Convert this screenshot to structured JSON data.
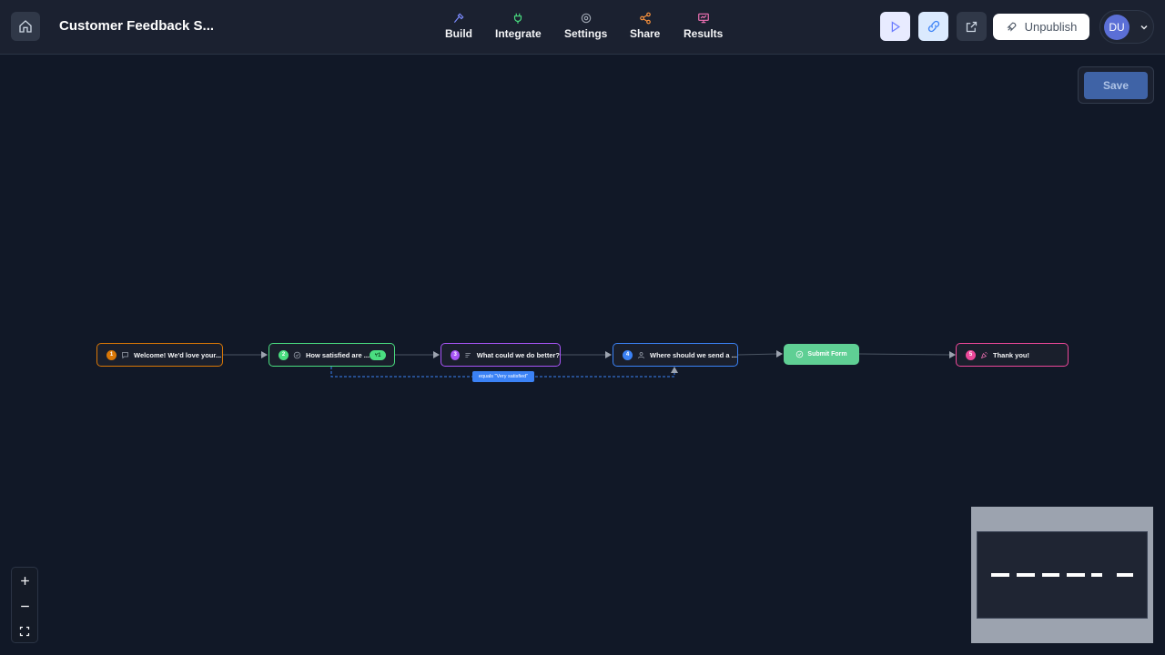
{
  "header": {
    "title": "Customer Feedback S...",
    "nav": [
      {
        "label": "Build",
        "icon": "hammer-icon",
        "color": "#6b7cff"
      },
      {
        "label": "Integrate",
        "icon": "plug-icon",
        "color": "#4ade80"
      },
      {
        "label": "Settings",
        "icon": "gear-icon",
        "color": "#9ca3af"
      },
      {
        "label": "Share",
        "icon": "share-icon",
        "color": "#fb923c"
      },
      {
        "label": "Results",
        "icon": "monitor-chart-icon",
        "color": "#f472b6"
      }
    ],
    "unpublish_label": "Unpublish",
    "avatar_initials": "DU"
  },
  "canvas": {
    "save_label": "Save",
    "nodes": [
      {
        "number": "1",
        "label": "Welcome! We'd love your...",
        "color": "#d97706",
        "icon": "message-icon"
      },
      {
        "number": "2",
        "label": "How satisfied are ...",
        "color": "#4ade80",
        "icon": "check-circle-icon",
        "badge": "1"
      },
      {
        "number": "3",
        "label": "What could we do better?",
        "color": "#a855f7",
        "icon": "text-lines-icon"
      },
      {
        "number": "4",
        "label": "Where should we send a ...",
        "color": "#3b82f6",
        "icon": "user-icon"
      },
      {
        "label": "Submit Form",
        "color": "#5fcf94",
        "icon": "check-circle-icon"
      },
      {
        "number": "5",
        "label": "Thank you!",
        "color": "#ec4899",
        "icon": "party-icon"
      }
    ],
    "condition_label": "equals \"Very satisfied\""
  }
}
